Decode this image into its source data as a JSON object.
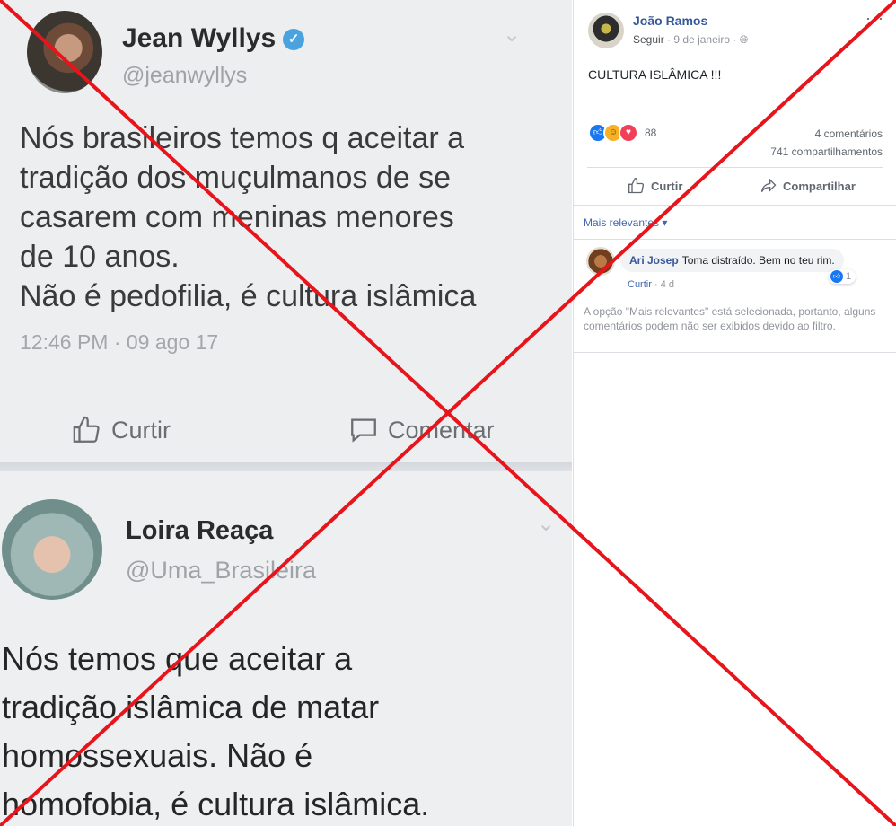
{
  "tweet1": {
    "name": "Jean Wyllys",
    "handle": "@jeanwyllys",
    "text": "Nós brasileiros temos q aceitar a\ntradição dos muçulmanos de se\ncasarem com meninas menores\nde 10 anos.\nNão é pedofilia, é cultura islâmica",
    "time": "12:46 PM · 09 ago 17",
    "like_label": "Curtir",
    "comment_label": "Comentar"
  },
  "tweet2": {
    "name": "Loira Reaça",
    "handle": "@Uma_Brasileira",
    "text": "Nós temos que aceitar a\ntradição islâmica de matar\nhomossexuais. Não é\nhomofobia, é cultura islâmica."
  },
  "post": {
    "author": "João Ramos",
    "follow": "Seguir",
    "date": "9 de janeiro",
    "more": "···",
    "text": "CULTURA ISLÂMICA !!!",
    "reaction_count": "88",
    "comments_count": "4 comentários",
    "shares_count": "741 compartilhamentos",
    "like_label": "Curtir",
    "share_label": "Compartilhar",
    "filter_label": "Mais relevantes"
  },
  "comment": {
    "author": "Ari Josep",
    "text": "Toma distraído. Bem no teu rim.",
    "likes": "1",
    "like_label": "Curtir",
    "age": "4 d"
  },
  "filter_notice": "A opção \"Mais relevantes\" está selecionada, portanto, alguns comentários podem não ser exibidos devido ao filtro.",
  "colors": {
    "x_mark": "#e8141b",
    "link": "#365899"
  },
  "icons": [
    "verified-icon",
    "chevron-down-icon",
    "thumbs-up-icon",
    "comment-icon",
    "globe-icon",
    "share-icon",
    "more-icon"
  ]
}
